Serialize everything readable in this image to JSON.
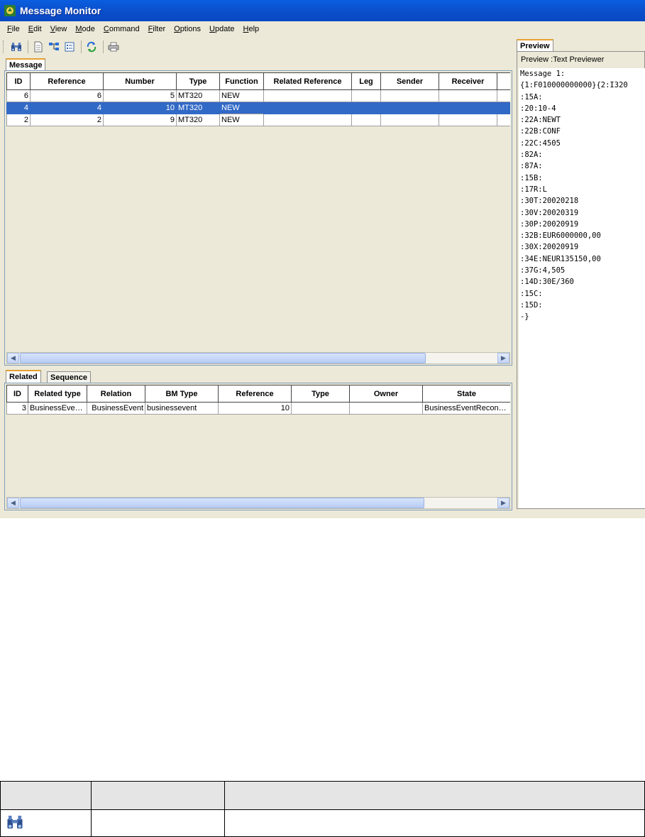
{
  "window": {
    "title": "Message Monitor"
  },
  "menu": [
    {
      "label": "File",
      "key": "F",
      "rest": "ile"
    },
    {
      "label": "Edit",
      "key": "E",
      "rest": "dit"
    },
    {
      "label": "View",
      "key": "V",
      "rest": "iew"
    },
    {
      "label": "Mode",
      "key": "M",
      "rest": "ode"
    },
    {
      "label": "Command",
      "key": "C",
      "rest": "ommand"
    },
    {
      "label": "Filter",
      "key": "F",
      "rest": "ilter"
    },
    {
      "label": "Options",
      "key": "O",
      "rest": "ptions"
    },
    {
      "label": "Update",
      "key": "U",
      "rest": "pdate"
    },
    {
      "label": "Help",
      "key": "H",
      "rest": "elp"
    }
  ],
  "toolbar": {
    "icons": [
      "binoculars-icon",
      "document-icon",
      "tree-icon",
      "list-icon",
      "refresh-icon",
      "print-icon"
    ]
  },
  "message_tab": {
    "label": "Message",
    "columns": [
      "ID",
      "Reference",
      "Number",
      "Type",
      "Function",
      "Related Reference",
      "Leg",
      "Sender",
      "Receiver",
      ""
    ],
    "rows": [
      {
        "id": "6",
        "reference": "6",
        "number": "5",
        "type": "MT320",
        "function": "NEW",
        "related_reference": "",
        "leg": "",
        "sender": "",
        "receiver": "",
        "selected": false
      },
      {
        "id": "4",
        "reference": "4",
        "number": "10",
        "type": "MT320",
        "function": "NEW",
        "related_reference": "",
        "leg": "",
        "sender": "",
        "receiver": "",
        "selected": true
      },
      {
        "id": "2",
        "reference": "2",
        "number": "9",
        "type": "MT320",
        "function": "NEW",
        "related_reference": "",
        "leg": "",
        "sender": "",
        "receiver": "",
        "selected": false
      }
    ]
  },
  "related_tabs": {
    "tabs": [
      "Related",
      "Sequence"
    ],
    "columns": [
      "ID",
      "Related type",
      "Relation",
      "BM Type",
      "Reference",
      "Type",
      "Owner",
      "State"
    ],
    "rows": [
      {
        "id": "3",
        "related_type": "BusinessEven...",
        "relation": "BusinessEvent",
        "bm_type": "businessevent",
        "reference": "10",
        "type": "",
        "owner": "",
        "state": "BusinessEventReconc..."
      }
    ]
  },
  "preview": {
    "tab": "Preview",
    "legend": "Preview :Text Previewer",
    "lines": [
      "Message 1:",
      "{1:F010000000000}{2:I320",
      ":15A:",
      ":20:10-4",
      ":22A:NEWT",
      ":22B:CONF",
      ":22C:4505",
      ":82A:",
      ":87A:",
      ":15B:",
      ":17R:L",
      ":30T:20020218",
      ":30V:20020319",
      ":30P:20020919",
      ":32B:EUR6000000,00",
      ":30X:20020919",
      ":34E:NEUR135150,00",
      ":37G:4,505",
      ":14D:30E/360",
      ":15C:",
      ":15D:",
      "-}"
    ]
  },
  "legend_table": {
    "headers": [
      "",
      "",
      ""
    ],
    "rows": [
      {
        "icon": "binoculars-icon",
        "col2": "",
        "col3": ""
      }
    ]
  }
}
